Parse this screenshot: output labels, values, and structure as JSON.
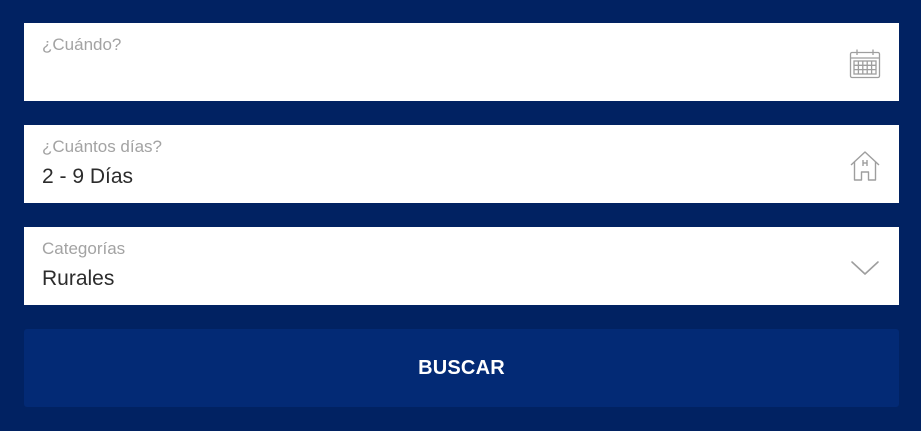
{
  "fields": [
    {
      "label": "¿Cuándo?",
      "value": "",
      "icon": "calendar-icon"
    },
    {
      "label": "¿Cuántos días?",
      "value": "2 - 9 Días",
      "icon": "house-icon"
    },
    {
      "label": "Categorías",
      "value": "Rurales",
      "icon": "chevron-down-icon"
    }
  ],
  "submit_label": "BUSCAR",
  "colors": {
    "background": "#012262",
    "button": "#032a75",
    "field_bg": "#ffffff",
    "label": "#a3a3a3",
    "value": "#2c2c2c",
    "icon": "#9e9e9e"
  }
}
